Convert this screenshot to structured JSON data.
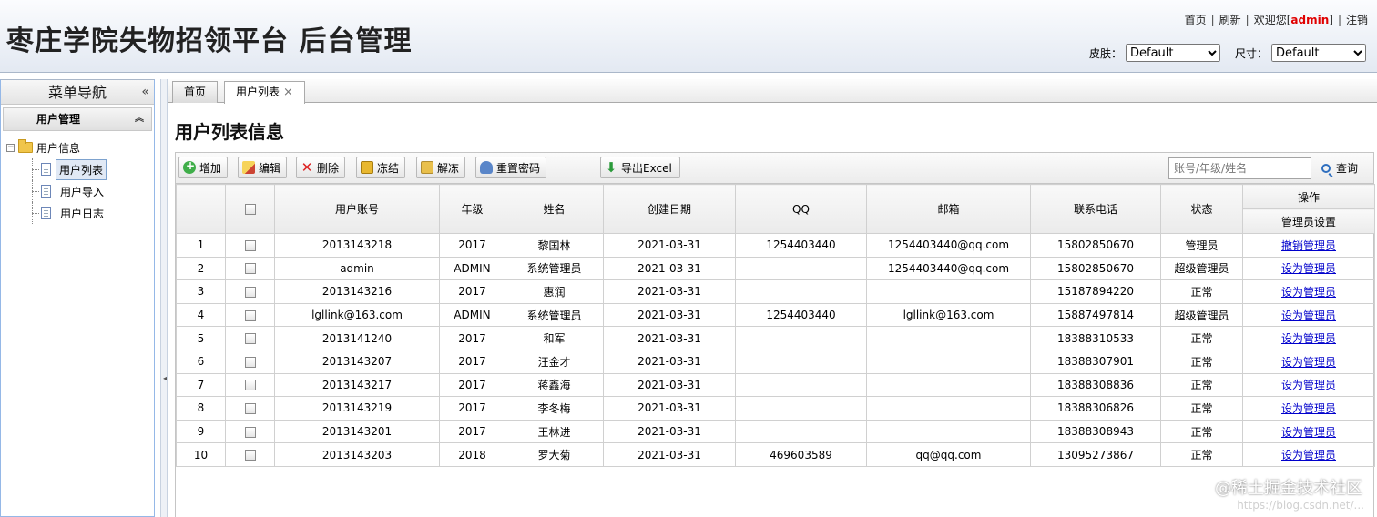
{
  "header": {
    "title": "枣庄学院失物招领平台 后台管理",
    "links": {
      "home": "首页",
      "refresh": "刷新",
      "welcome": "欢迎您[",
      "user": "admin",
      "welcome_end": "]",
      "logout": "注销"
    },
    "skin_label": "皮肤：",
    "skin_value": "Default",
    "size_label": "尺寸：",
    "size_value": "Default"
  },
  "sidebar": {
    "title": "菜单导航",
    "collapse_icon": "«",
    "group": "用户管理",
    "group_ctrl": "︽",
    "tree": {
      "root": "用户信息",
      "children": [
        {
          "label": "用户列表",
          "selected": true
        },
        {
          "label": "用户导入",
          "selected": false
        },
        {
          "label": "用户日志",
          "selected": false
        }
      ]
    }
  },
  "tabs": [
    {
      "label": "首页",
      "active": false
    },
    {
      "label": "用户列表",
      "active": true,
      "close": "×"
    }
  ],
  "page_heading": "用户列表信息",
  "toolbar": {
    "buttons": [
      "增加",
      "编辑",
      "删除",
      "冻结",
      "解冻",
      "重置密码"
    ],
    "export": "导出Excel",
    "search_placeholder": "账号/年级/姓名",
    "search_label": "查询"
  },
  "table": {
    "headers": [
      "用户账号",
      "年级",
      "姓名",
      "创建日期",
      "QQ",
      "邮箱",
      "联系电话",
      "状态"
    ],
    "op_header": "操作",
    "op_sub_header": "管理员设置",
    "rows": [
      {
        "no": "1",
        "account": "2013143218",
        "grade": "2017",
        "name": "黎国林",
        "date": "2021-03-31",
        "qq": "1254403440",
        "email": "1254403440@qq.com",
        "phone": "15802850670",
        "status": "管理员",
        "action": "撤销管理员"
      },
      {
        "no": "2",
        "account": "admin",
        "grade": "ADMIN",
        "name": "系统管理员",
        "date": "2021-03-31",
        "qq": "",
        "email": "1254403440@qq.com",
        "phone": "15802850670",
        "status": "超级管理员",
        "action": "设为管理员"
      },
      {
        "no": "3",
        "account": "2013143216",
        "grade": "2017",
        "name": "惠润",
        "date": "2021-03-31",
        "qq": "",
        "email": "",
        "phone": "15187894220",
        "status": "正常",
        "action": "设为管理员"
      },
      {
        "no": "4",
        "account": "lgllink@163.com",
        "grade": "ADMIN",
        "name": "系统管理员",
        "date": "2021-03-31",
        "qq": "1254403440",
        "email": "lgllink@163.com",
        "phone": "15887497814",
        "status": "超级管理员",
        "action": "设为管理员"
      },
      {
        "no": "5",
        "account": "2013141240",
        "grade": "2017",
        "name": "和军",
        "date": "2021-03-31",
        "qq": "",
        "email": "",
        "phone": "18388310533",
        "status": "正常",
        "action": "设为管理员"
      },
      {
        "no": "6",
        "account": "2013143207",
        "grade": "2017",
        "name": "汪金才",
        "date": "2021-03-31",
        "qq": "",
        "email": "",
        "phone": "18388307901",
        "status": "正常",
        "action": "设为管理员"
      },
      {
        "no": "7",
        "account": "2013143217",
        "grade": "2017",
        "name": "蒋鑫海",
        "date": "2021-03-31",
        "qq": "",
        "email": "",
        "phone": "18388308836",
        "status": "正常",
        "action": "设为管理员"
      },
      {
        "no": "8",
        "account": "2013143219",
        "grade": "2017",
        "name": "李冬梅",
        "date": "2021-03-31",
        "qq": "",
        "email": "",
        "phone": "18388306826",
        "status": "正常",
        "action": "设为管理员"
      },
      {
        "no": "9",
        "account": "2013143201",
        "grade": "2017",
        "name": "王林进",
        "date": "2021-03-31",
        "qq": "",
        "email": "",
        "phone": "18388308943",
        "status": "正常",
        "action": "设为管理员"
      },
      {
        "no": "10",
        "account": "2013143203",
        "grade": "2018",
        "name": "罗大菊",
        "date": "2021-03-31",
        "qq": "469603589",
        "email": "qq@qq.com",
        "phone": "13095273867",
        "status": "正常",
        "action": "设为管理员"
      }
    ]
  },
  "watermark": "@稀土掘金技术社区",
  "watermark_url": "https://blog.csdn.net/..."
}
